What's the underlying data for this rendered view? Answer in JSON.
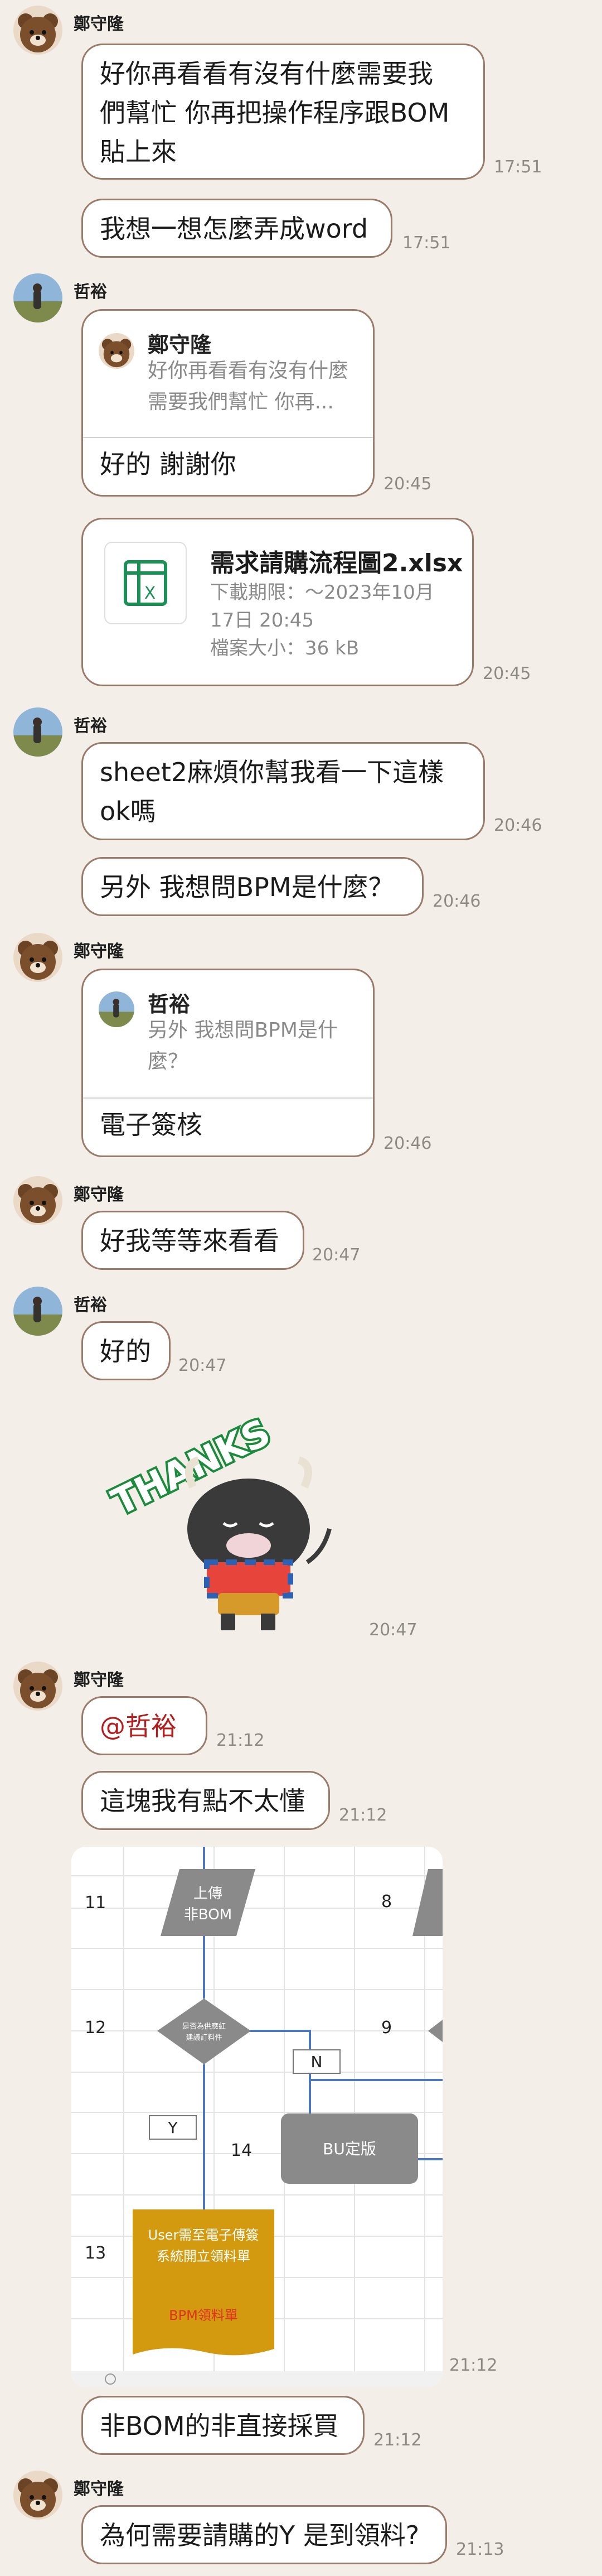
{
  "messages": {
    "m1": {
      "sender": "鄭守隆",
      "text": [
        "好你再看看有沒有什麼需要我",
        "們幫忙 你再把操作程序跟BOM",
        "貼上來"
      ],
      "time": "17:51"
    },
    "m2": {
      "text": "我想一想怎麼弄成word",
      "time": "17:51"
    },
    "m3": {
      "sender": "哲裕",
      "quote_name": "鄭守隆",
      "quote_text": "好你再看看有沒有什麼需要我們幫忙 你再...",
      "text": "好的 謝謝你",
      "time": "20:45"
    },
    "m4": {
      "file_name": "需求請購流程圖2.xlsx",
      "file_expiry": "下載期限：～2023年10月17日 20:45",
      "file_size": "檔案大小：36 kB",
      "time": "20:45"
    },
    "m5": {
      "sender": "哲裕",
      "text": [
        "sheet2麻煩你幫我看一下這樣",
        "ok嗎"
      ],
      "time": "20:46"
    },
    "m6": {
      "text": "另外 我想問BPM是什麼？",
      "time": "20:46"
    },
    "m7": {
      "sender": "鄭守隆",
      "quote_name": "哲裕",
      "quote_text": "另外 我想問BPM是什麼？",
      "text": "電子簽核",
      "time": "20:46"
    },
    "m8": {
      "sender": "鄭守隆",
      "text": "好我等等來看看",
      "time": "20:47"
    },
    "m9": {
      "sender": "哲裕",
      "text": "好的",
      "time": "20:47"
    },
    "m10": {
      "sticker_text": "THANKS",
      "time": "20:47"
    },
    "m11": {
      "sender": "鄭守隆",
      "mention": "@哲裕",
      "time": "21:12"
    },
    "m12": {
      "text": "這塊我有點不太懂",
      "time": "21:12"
    },
    "m13": {
      "time": "21:12",
      "rows": [
        "11",
        "12",
        "13",
        "14",
        "8",
        "9"
      ],
      "shapes": {
        "upload": [
          "上傳",
          "非BOM"
        ],
        "decision": [
          "是否為供應紅",
          "建議訂料件"
        ],
        "no": "N",
        "yes": "Y",
        "bu": "BU定版",
        "user": [
          "User需至電子傳簽",
          "系統開立領料單"
        ],
        "bpm": "BPM領料單"
      }
    },
    "m14": {
      "text": "非BOM的非直接採買",
      "time": "21:12"
    },
    "m15": {
      "sender": "鄭守隆",
      "text": "為何需要請購的Y 是到領料?",
      "time": "21:13"
    }
  },
  "colors": {
    "background": "#f3eee8",
    "bubble_border": "#9a7b6a",
    "mention": "#b41d1d",
    "sheet_gray": "#8a8a8a",
    "sheet_gold": "#d49a0f",
    "excel_green": "#1c8f56"
  }
}
